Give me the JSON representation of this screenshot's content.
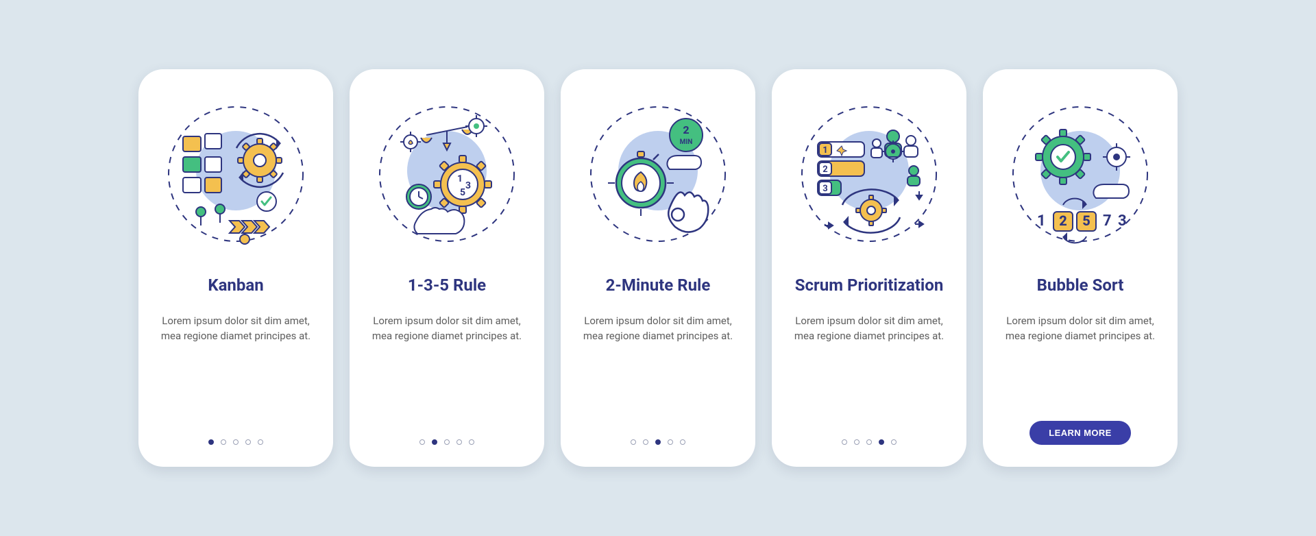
{
  "colors": {
    "bg": "#dce6ed",
    "card": "#ffffff",
    "primary": "#2e357f",
    "accentBlue": "#becfee",
    "yellow": "#f4c04f",
    "green": "#44bf80",
    "stroke": "#2e357f",
    "text": "#5e5e5e",
    "button": "#3a3ea7"
  },
  "cards": [
    {
      "id": "kanban",
      "title": "Kanban",
      "desc": "Lorem ipsum dolor sit dim amet, mea regione diamet principes at.",
      "dotsTotal": 5,
      "activeDot": 0,
      "hasButton": false
    },
    {
      "id": "rule135",
      "title": "1-3-5 Rule",
      "desc": "Lorem ipsum dolor sit dim amet, mea regione diamet principes at.",
      "dotsTotal": 5,
      "activeDot": 1,
      "hasButton": false
    },
    {
      "id": "twominute",
      "title": "2-Minute Rule",
      "desc": "Lorem ipsum dolor sit dim amet, mea regione diamet principes at.",
      "dotsTotal": 5,
      "activeDot": 2,
      "hasButton": false
    },
    {
      "id": "scrum",
      "title": "Scrum Prioritization",
      "desc": "Lorem ipsum dolor sit dim amet, mea regione diamet principes at.",
      "dotsTotal": 5,
      "activeDot": 3,
      "hasButton": false
    },
    {
      "id": "bubblesort",
      "title": "Bubble Sort",
      "desc": "Lorem ipsum dolor sit dim amet, mea regione diamet principes at.",
      "dotsTotal": 5,
      "activeDot": 4,
      "hasButton": true,
      "buttonLabel": "LEARN MORE"
    }
  ]
}
